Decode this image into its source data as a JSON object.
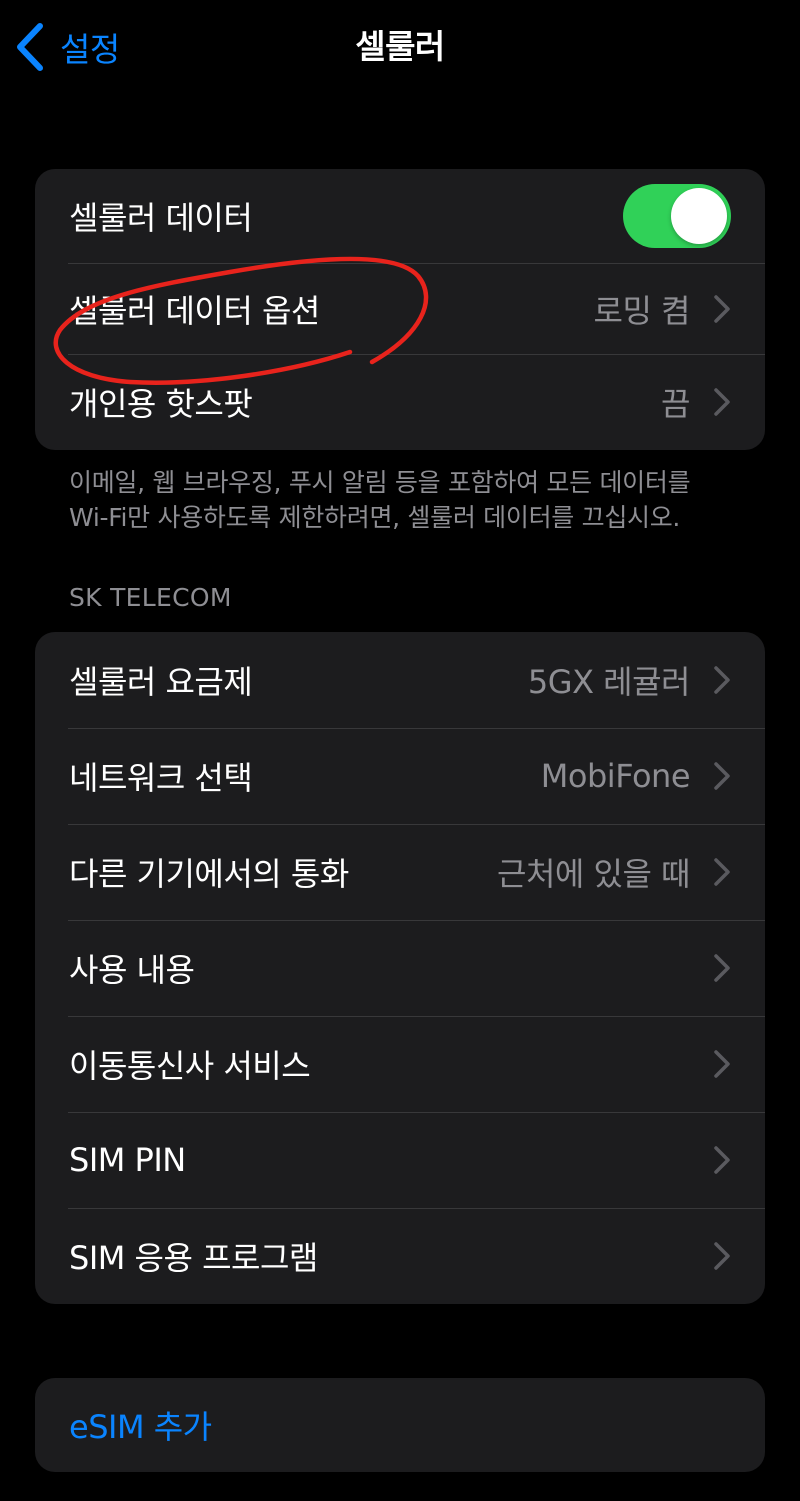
{
  "nav": {
    "back_label": "설정",
    "title": "셀룰러"
  },
  "group1": {
    "cellular_data": {
      "label": "셀룰러 데이터",
      "toggle_on": true
    },
    "cellular_data_options": {
      "label": "셀룰러 데이터 옵션",
      "value": "로밍 켬"
    },
    "personal_hotspot": {
      "label": "개인용 핫스팟",
      "value": "끔"
    },
    "footer_line1": "이메일, 웹 브라우징, 푸시 알림 등을 포함하여 모든 데이터를",
    "footer_line2": "Wi-Fi만 사용하도록 제한하려면, 셀룰러 데이터를 끄십시오."
  },
  "carrier": {
    "header": "SK TELECOM",
    "rows": [
      {
        "label": "셀룰러 요금제",
        "value": "5GX 레귤러"
      },
      {
        "label": "네트워크 선택",
        "value": "MobiFone"
      },
      {
        "label": "다른 기기에서의 통화",
        "value": "근처에 있을 때"
      },
      {
        "label": "사용 내용",
        "value": ""
      },
      {
        "label": "이동통신사 서비스",
        "value": ""
      },
      {
        "label": "SIM PIN",
        "value": ""
      },
      {
        "label": "SIM 응용 프로그램",
        "value": ""
      }
    ]
  },
  "esim": {
    "add_label": "eSIM 추가"
  },
  "colors": {
    "accent": "#0a84ff",
    "toggle_on": "#30d158",
    "annotation": "#e8231c"
  },
  "icons": [
    "chevron-left-icon",
    "chevron-right-icon"
  ]
}
